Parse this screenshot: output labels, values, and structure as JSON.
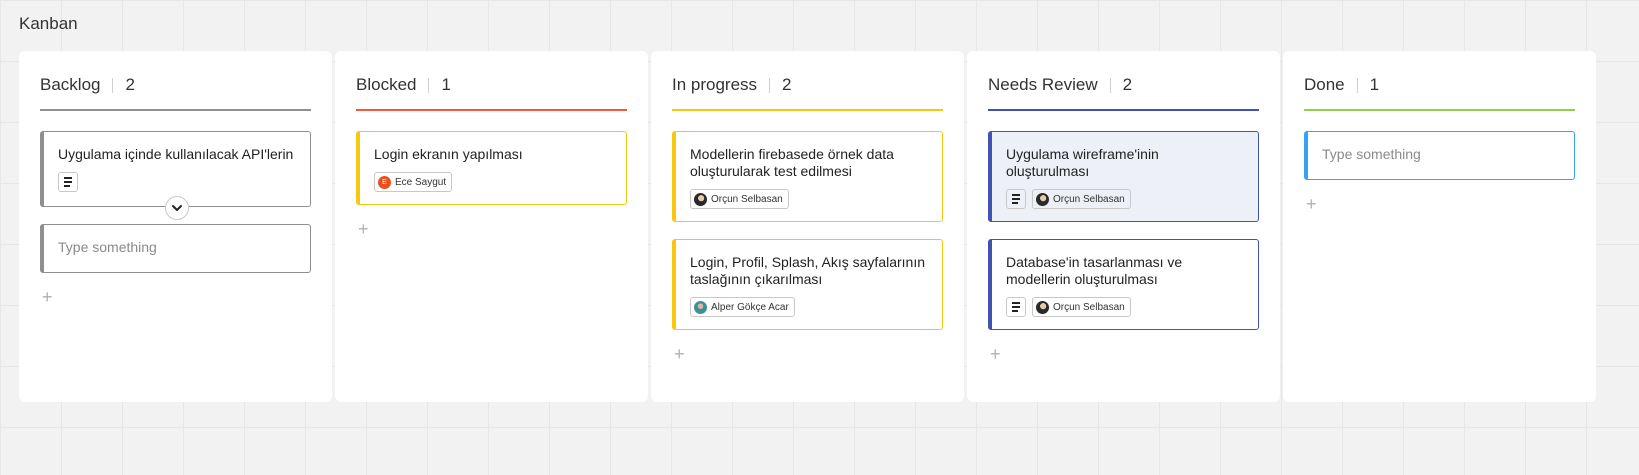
{
  "board": {
    "title": "Kanban"
  },
  "colors": {
    "backlog": "#8f8f8f",
    "blocked": "#f15a3a",
    "in_progress": "#fac710",
    "needs_review": "#4252b3",
    "done": "#8fd14f",
    "input_focus": "#3aa0f3",
    "card_selected_bg": "#eef0f8"
  },
  "icons": {
    "description": "description-icon",
    "expand": "chevron-down-icon",
    "add": "plus-icon",
    "avatar": "user-avatar-icon"
  },
  "columns": [
    {
      "name": "Backlog",
      "count": "2",
      "color": "#8f8f8f",
      "cards": [
        {
          "title": "Uygulama içinde kullanılacak API'lerin",
          "has_description": true,
          "assignee": null,
          "expanded_toggle": true
        }
      ],
      "input_placeholder": "Type something"
    },
    {
      "name": "Blocked",
      "count": "1",
      "color": "#f15a3a",
      "cards": [
        {
          "title": "Login ekranın yapılması",
          "has_description": false,
          "assignee": "Ece Saygut",
          "assignee_initial": "E"
        }
      ]
    },
    {
      "name": "In progress",
      "count": "2",
      "color": "#fac710",
      "cards": [
        {
          "title": "Modellerin firebasede örnek data oluşturularak test edilmesi",
          "has_description": false,
          "assignee": "Orçun Selbasan"
        },
        {
          "title": "Login, Profil, Splash, Akış sayfalarının taslağının çıkarılması",
          "has_description": false,
          "assignee": "Alper Gökçe Acar"
        }
      ]
    },
    {
      "name": "Needs Review",
      "count": "2",
      "color": "#4252b3",
      "cards": [
        {
          "title": "Uygulama wireframe'inin oluşturulması",
          "has_description": true,
          "assignee": "Orçun Selbasan",
          "selected": true
        },
        {
          "title": "Database'in tasarlanması ve modellerin oluşturulması",
          "has_description": true,
          "assignee": "Orçun Selbasan"
        }
      ]
    },
    {
      "name": "Done",
      "count": "1",
      "color": "#8fd14f",
      "cards": [],
      "input_placeholder": "Type something"
    }
  ]
}
